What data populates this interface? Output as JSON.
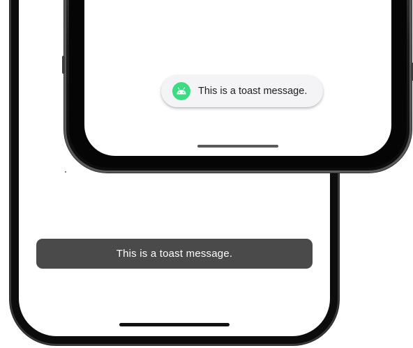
{
  "ios_phone": {
    "toast": {
      "message": "This is a toast message.",
      "background": "#4a4a4a",
      "text_color": "#ffffff"
    }
  },
  "android_phone": {
    "toast": {
      "message": "This is a toast message.",
      "icon": "android-robot-icon",
      "icon_color": "#3ddc84",
      "background": "#f4f4f6",
      "text_color": "#1e1e1e"
    }
  }
}
